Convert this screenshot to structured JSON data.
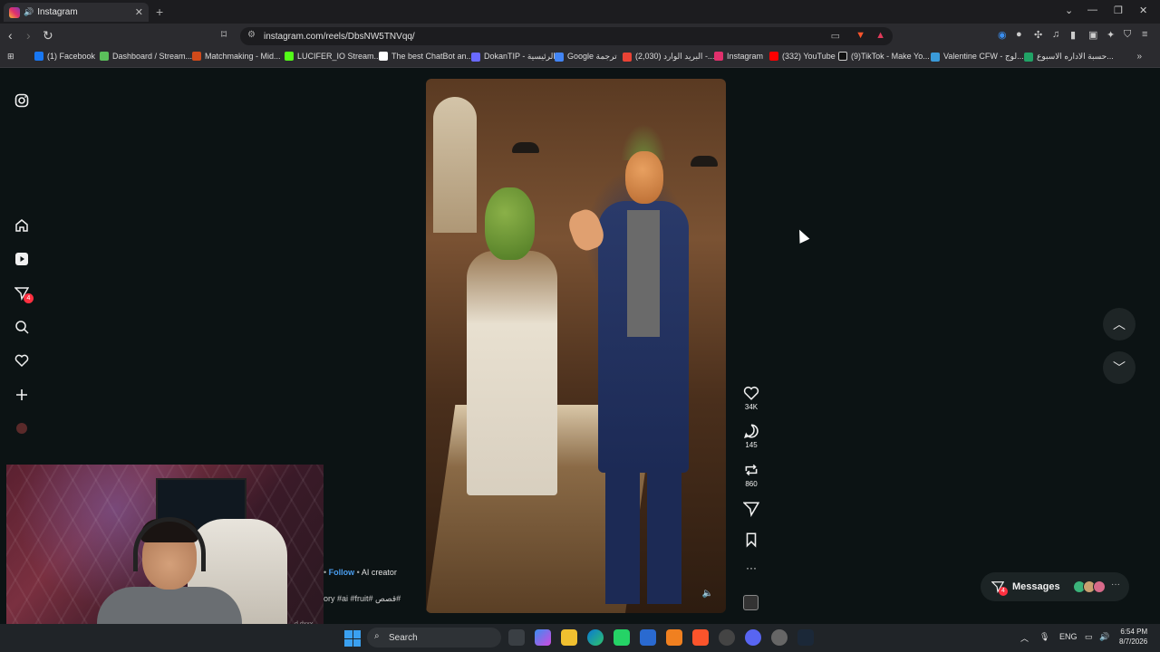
{
  "browser": {
    "tab_title": "Instagram",
    "url": "instagram.com/reels/DbsNW5TNVqq/",
    "bookmarks": [
      {
        "label": "(1) Facebook",
        "color": "#1877f2"
      },
      {
        "label": "Dashboard / Stream...",
        "color": "#5bbf5b"
      },
      {
        "label": "Matchmaking - Mid...",
        "color": "#d04a1a"
      },
      {
        "label": "LUCIFER_IO Stream...",
        "color": "#53fc18"
      },
      {
        "label": "The best ChatBot an...",
        "color": "#ffffff"
      },
      {
        "label": "DokanTIP - الرئيسية",
        "color": "#6a6aff"
      },
      {
        "label": "Google ترجمة",
        "color": "#4285f4"
      },
      {
        "label": "(2,030) البريد الوارد -...",
        "color": "#ea4335"
      },
      {
        "label": "Instagram",
        "color": "#e1306c"
      },
      {
        "label": "(332) YouTube",
        "color": "#ff0000"
      },
      {
        "label": "(9)TikTok - Make Yo...",
        "color": "#111111"
      },
      {
        "label": "Valentine CFW - لوج...",
        "color": "#3a9ad9"
      },
      {
        "label": "حسبة الاداره الاسبوع...",
        "color": "#21a366"
      }
    ]
  },
  "sidebar": {
    "messages_badge": "4"
  },
  "reel": {
    "likes": "34K",
    "comments": "145",
    "reposts": "860",
    "follow_label": "Follow",
    "creator_tag": "AI creator",
    "caption": "ory #ai #fruit# قصص#",
    "cam_watermark": "d dxxx"
  },
  "messages": {
    "label": "Messages",
    "badge": "4",
    "avatar_colors": [
      "#3bb37a",
      "#c9a070",
      "#d86a8a"
    ]
  },
  "taskbar": {
    "search_placeholder": "Search",
    "language": "ENG",
    "time": "6:54 PM",
    "date": "8/7/2026"
  },
  "colors": {
    "page_bg": "#0c1314",
    "follow_link": "#4a9ef0",
    "notification_badge": "#ff3040"
  }
}
